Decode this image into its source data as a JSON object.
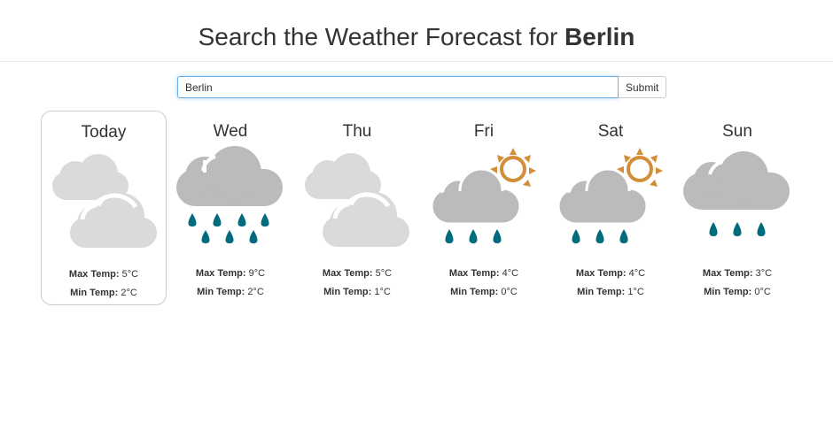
{
  "header": {
    "title_prefix": "Search the Weather Forecast for",
    "city": "Berlin"
  },
  "search": {
    "value": "Berlin",
    "submit_label": "Submit"
  },
  "colors": {
    "accent_input_border": "#66afe9",
    "cloud_light": "#dadada",
    "cloud_dark": "#bbbbbb",
    "rain": "#006b7d",
    "sun": "#d28f38"
  },
  "labels": {
    "max": "Max Temp:",
    "min": "Min Temp:"
  },
  "days": [
    {
      "name": "Today",
      "icon": "cloudy-icon",
      "max": "5°C",
      "min": "2°C",
      "selected": true
    },
    {
      "name": "Wed",
      "icon": "heavy-rain-icon",
      "max": "9°C",
      "min": "2°C",
      "selected": false
    },
    {
      "name": "Thu",
      "icon": "cloudy-icon",
      "max": "5°C",
      "min": "1°C",
      "selected": false
    },
    {
      "name": "Fri",
      "icon": "sun-rain-icon",
      "max": "4°C",
      "min": "0°C",
      "selected": false
    },
    {
      "name": "Sat",
      "icon": "sun-rain-icon",
      "max": "4°C",
      "min": "1°C",
      "selected": false
    },
    {
      "name": "Sun",
      "icon": "rain-icon",
      "max": "3°C",
      "min": "0°C",
      "selected": false
    }
  ]
}
